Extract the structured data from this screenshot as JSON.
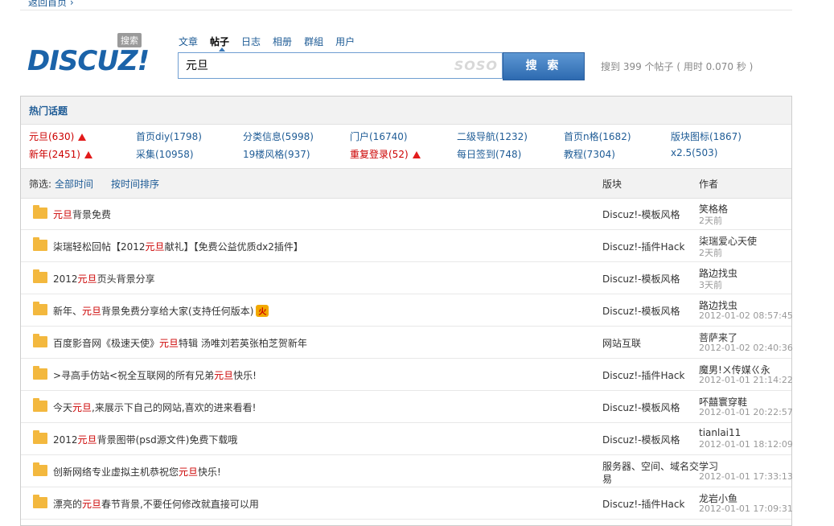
{
  "topbar": {
    "text": "返回首页 ›"
  },
  "logo": {
    "word": "DISCUZ!",
    "tag": "搜索"
  },
  "tabs": [
    "文章",
    "帖子",
    "日志",
    "相册",
    "群組",
    "用户"
  ],
  "search": {
    "value": "元旦",
    "brand": "SOSO",
    "button": "搜 索"
  },
  "result_text": "搜到 399 个帖子 ( 用时 0.070 秒 )",
  "hot": {
    "title": "热门话题",
    "items": [
      {
        "label": "元旦(630)",
        "red": true,
        "arrow": true
      },
      {
        "label": "首页diy(1798)"
      },
      {
        "label": "分类信息(5998)"
      },
      {
        "label": "门户(16740)"
      },
      {
        "label": "二级导航(1232)"
      },
      {
        "label": "首页n格(1682)"
      },
      {
        "label": "版块图标(1867)"
      },
      {
        "label": "新年(2451)",
        "red": true,
        "arrow": true
      },
      {
        "label": "采集(10958)"
      },
      {
        "label": "19楼风格(937)"
      },
      {
        "label": "重复登录(52)",
        "red": true,
        "arrow": true
      },
      {
        "label": "每日签到(748)"
      },
      {
        "label": "教程(7304)"
      },
      {
        "label": "x2.5(503)"
      }
    ]
  },
  "filter": {
    "label": "筛选:",
    "opt1": "全部时间",
    "opt2": "按时间排序",
    "col_forum": "版块",
    "col_author": "作者"
  },
  "rows": [
    {
      "pre": "",
      "hl": "元旦",
      "post": "背景免费",
      "forum": "Discuz!-模板风格",
      "author": "笑格格",
      "time": "2天前"
    },
    {
      "pre": "柒瑞轻松回帖【2012",
      "hl": "元旦",
      "post": "献礼】【免费公益优质dx2插件】",
      "forum": "Discuz!-插件Hack",
      "author": "柒瑞爱心天使",
      "time": "2天前"
    },
    {
      "pre": "2012",
      "hl": "元旦",
      "post": "页头背景分享",
      "forum": "Discuz!-模板风格",
      "author": "路边找虫",
      "time": "3天前"
    },
    {
      "pre": "新年、",
      "hl": "元旦",
      "post": "背景免费分享给大家(支持任何版本)",
      "hot": "火",
      "forum": "Discuz!-模板风格",
      "author": "路边找虫",
      "time": "2012-01-02 08:57:45"
    },
    {
      "pre": "百度影音网《极速天使》",
      "hl": "元旦",
      "post": "特辑 汤唯刘若英张柏芝贺新年",
      "forum": "网站互联",
      "author": "菩萨来了",
      "time": "2012-01-02 02:40:36"
    },
    {
      "pre": ">寻高手仿站<祝全互联网的所有兄弟",
      "hl": "元旦",
      "post": "快乐!",
      "forum": "Discuz!-插件Hack",
      "author": "魔男!ㄨ传媒ㄍ永",
      "time": "2012-01-01 21:14:22"
    },
    {
      "pre": "今天",
      "hl": "元旦",
      "post": ",来展示下自己的网站,喜欢的进来看看!",
      "forum": "Discuz!-模板风格",
      "author": "吥囍寰穿鞋",
      "time": "2012-01-01 20:22:57"
    },
    {
      "pre": "2012",
      "hl": "元旦",
      "post": "背景图带(psd源文件)免费下载哦",
      "forum": "Discuz!-模板风格",
      "author": "tianlai11",
      "time": "2012-01-01 18:12:09"
    },
    {
      "pre": "创新网络专业虚拟主机恭祝您",
      "hl": "元旦",
      "post": "快乐!",
      "forum": "服务器、空间、域名交易",
      "author": "学习",
      "time": "2012-01-01 17:33:13",
      "wrap": true
    },
    {
      "pre": "漂亮的",
      "hl": "元旦",
      "post": "春节背景,不要任何修改就直接可以用",
      "forum": "Discuz!-插件Hack",
      "author": "龙岩小鱼",
      "time": "2012-01-01 17:09:31"
    }
  ]
}
